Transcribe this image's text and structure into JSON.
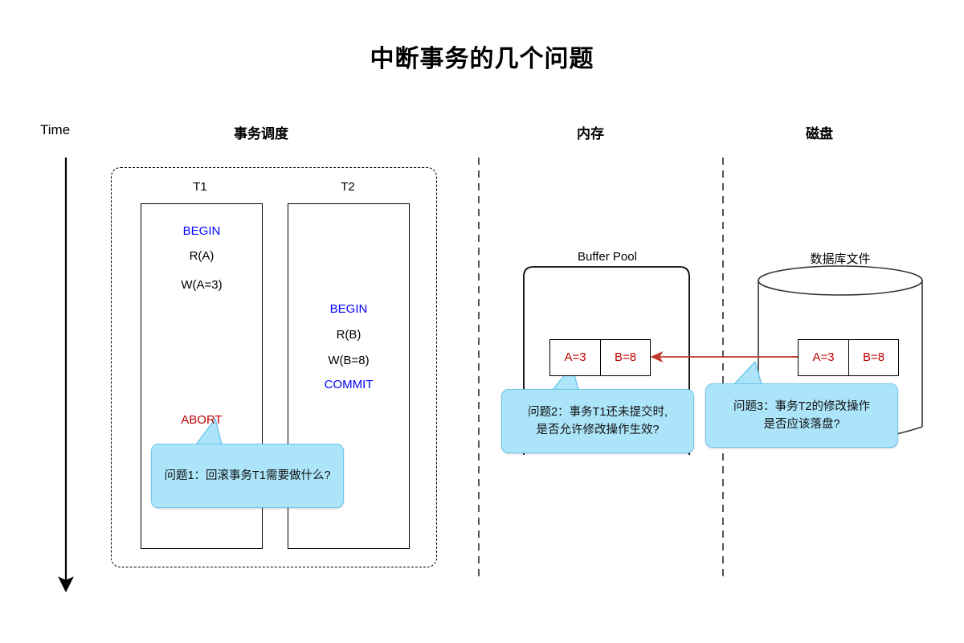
{
  "page": {
    "title": "中断事务的几个问题",
    "bg_color": "#ffffff"
  },
  "colors": {
    "keyword_blue": "#0000ff",
    "abort_red": "#c00000",
    "value_red": "#c00000",
    "callout_fill": "#ace5fa",
    "callout_border": "#6ec6ef",
    "arrow_red": "#c0392b",
    "line_black": "#000000"
  },
  "headers": {
    "time": "Time",
    "schedule": "事务调度",
    "memory": "内存",
    "disk": "磁盘"
  },
  "timeline": {
    "icon": "down-arrow-icon",
    "direction": "down"
  },
  "schedule": {
    "transactions": [
      {
        "name": "T1",
        "ops": [
          {
            "text": "BEGIN",
            "kind": "keyword"
          },
          {
            "text": "R(A)",
            "kind": "normal"
          },
          {
            "text": "W(A=3)",
            "kind": "normal"
          },
          {
            "text": "ABORT",
            "kind": "abort"
          }
        ]
      },
      {
        "name": "T2",
        "ops": [
          {
            "text": "BEGIN",
            "kind": "keyword"
          },
          {
            "text": "R(B)",
            "kind": "normal"
          },
          {
            "text": "W(B=8)",
            "kind": "normal"
          },
          {
            "text": "COMMIT",
            "kind": "keyword"
          }
        ]
      }
    ]
  },
  "memory": {
    "buffer_pool_label": "Buffer Pool",
    "cells": [
      {
        "text": "A=3"
      },
      {
        "text": "B=8"
      }
    ]
  },
  "disk": {
    "db_file_label": "数据库文件",
    "cells": [
      {
        "text": "A=3"
      },
      {
        "text": "B=8"
      }
    ]
  },
  "flush_arrow": {
    "name": "disk-to-buffer-arrow",
    "color": "#c0392b",
    "direction": "left"
  },
  "callouts": [
    {
      "id": "callout-1",
      "lines": [
        "问题1：回滚事务T1需要做什么?"
      ],
      "anchor": "ABORT"
    },
    {
      "id": "callout-2",
      "lines": [
        "问题2：事务T1还未提交时,",
        "是否允许修改操作生效?"
      ],
      "anchor": "Buffer Pool"
    },
    {
      "id": "callout-3",
      "lines": [
        "问题3：事务T2的修改操作",
        "是否应该落盘?"
      ],
      "anchor": "数据库文件"
    }
  ]
}
